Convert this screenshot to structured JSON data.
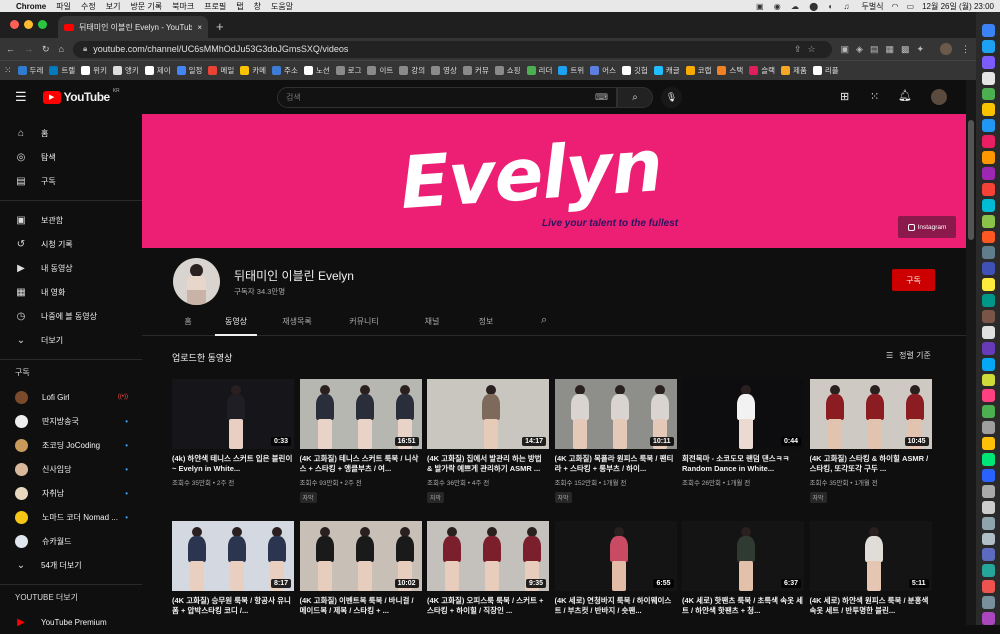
{
  "menubar": {
    "app": "Chrome",
    "items": [
      "파일",
      "수정",
      "보기",
      "방문 기록",
      "북마크",
      "프로필",
      "탭",
      "창",
      "도움말"
    ],
    "right_text": "두벌식",
    "datetime": "12월 26일 (월) 23:00"
  },
  "tab": {
    "title": "뒤태미인 이블린 Evelyn - YouTube",
    "close": "×",
    "new": "+"
  },
  "url": {
    "text": "youtube.com/channel/UC6sMMhOdJu53G3doJGmsSXQ/videos"
  },
  "bookmarks": [
    "두레",
    "트렐",
    "위키",
    "앵키",
    "제이",
    "일정",
    "메일",
    "카메",
    "주소",
    "노션",
    "로그",
    "이트",
    "강의",
    "영상",
    "커뮤",
    "쇼핑",
    "리더",
    "트위",
    "어스",
    "깃헙",
    "캐글",
    "코랩",
    "스택",
    "슬랙",
    "제품",
    "리플"
  ],
  "bookmark_colors": [
    "#2e7bcf",
    "#0079bf",
    "#fff",
    "#ddd",
    "#fff",
    "#4285f4",
    "#ea4335",
    "#f9c300",
    "#3d7bd5",
    "#fff",
    "#8a8a8a",
    "#8a8a8a",
    "#8a8a8a",
    "#8a8a8a",
    "#8a8a8a",
    "#8a8a8a",
    "#4caf50",
    "#1da1f2",
    "#5a7fe0",
    "#fff",
    "#20beff",
    "#f9ab00",
    "#f48024",
    "#e01e5a",
    "#f5a623",
    "#fff"
  ],
  "yt": {
    "logo": "YouTube",
    "region": "KR",
    "search_placeholder": "검색",
    "sidebar": {
      "main": [
        {
          "label": "홈",
          "icon": "home-icon",
          "glyph": "⌂"
        },
        {
          "label": "탐색",
          "icon": "explore-icon",
          "glyph": "◎"
        },
        {
          "label": "구독",
          "icon": "subscriptions-icon",
          "glyph": "▤"
        }
      ],
      "library": [
        {
          "label": "보관함",
          "icon": "library-icon",
          "glyph": "▣"
        },
        {
          "label": "시청 기록",
          "icon": "history-icon",
          "glyph": "↺"
        },
        {
          "label": "내 동영상",
          "icon": "my-videos-icon",
          "glyph": "▶"
        },
        {
          "label": "내 영화",
          "icon": "my-movies-icon",
          "glyph": "▦"
        },
        {
          "label": "나중에 볼 동영상",
          "icon": "watch-later-icon",
          "glyph": "◷"
        },
        {
          "label": "더보기",
          "icon": "chevron-down-icon",
          "glyph": "⌄"
        }
      ],
      "subs_title": "구독",
      "subs": [
        {
          "label": "Lofi Girl",
          "color": "#7a4a2a",
          "badge": "((•))",
          "badge_color": "#ff4e45"
        },
        {
          "label": "딴지방송국",
          "color": "#eee",
          "badge": "•",
          "badge_color": "#3ea6ff"
        },
        {
          "label": "조코딩 JoCoding",
          "color": "#c99a5a",
          "badge": "•",
          "badge_color": "#3ea6ff"
        },
        {
          "label": "신사임당",
          "color": "#d9b99b",
          "badge": "•",
          "badge_color": "#3ea6ff"
        },
        {
          "label": "자취남",
          "color": "#e9d8c0",
          "badge": "•",
          "badge_color": "#3ea6ff"
        },
        {
          "label": "노마드 코더 Nomad ...",
          "color": "#f5c518",
          "badge": "•",
          "badge_color": "#3ea6ff"
        },
        {
          "label": "슈카월드",
          "color": "#dfe6ee",
          "badge": "",
          "badge_color": "#3ea6ff"
        }
      ],
      "more_subs": "54개 더보기",
      "more_title": "YOUTUBE 더보기",
      "premium": "YouTube Premium"
    },
    "banner": {
      "title": "Evelyn",
      "tagline": "Live your talent to the fullest",
      "instagram": "Instagram"
    },
    "channel": {
      "name": "뒤태미인 이블린 Evelyn",
      "subscribers": "구독자 34.3만명",
      "subscribe": "구독"
    },
    "tabs": [
      "홈",
      "동영상",
      "재생목록",
      "커뮤니티",
      "채널",
      "정보"
    ],
    "active_tab": 1,
    "section_title": "업로드한 동영상",
    "sort_label": "정렬 기준",
    "videos": [
      {
        "title": "(4k) 하얀색 테니스 스커트 입은 블린이~ Evelyn in White...",
        "meta": "조회수 35만회 • 2주 전",
        "dur": "0:33",
        "cc": "",
        "bg": "#15151a",
        "skin": "#e8cfc2",
        "cloth": "#1e1e24"
      },
      {
        "title": "(4K 고화질) 테니스 스커트 룩북 / 니삭스 + 스타킹 + 앵클부츠 / 여...",
        "meta": "조회수 93만회 • 2주 전",
        "dur": "16:51",
        "cc": "자막",
        "bg": "#b7b7b2",
        "skin": "#e9d2c6",
        "cloth": "#2a2d3a"
      },
      {
        "title": "(4K 고화질) 집에서 발관리 하는 방법 & 발가락 예쁘게 관리하기 ASMR ...",
        "meta": "조회수 36만회 • 4주 전",
        "dur": "14:17",
        "cc": "자막",
        "bg": "#c9c5bf",
        "skin": "#e7cbb9",
        "cloth": "#7d6a5b"
      },
      {
        "title": "(4K 고화질) 목폴라 원피스 룩북 / 팬티라 + 스타킹 + 롱부츠 / 하이...",
        "meta": "조회수 152만회 • 1개월 전",
        "dur": "10:11",
        "cc": "자막",
        "bg": "#8e8e8a",
        "skin": "#e4c9b8",
        "cloth": "#d9d4cf"
      },
      {
        "title": "회전목마 - 소코도모 랜덤 댄스ㅋㅋ Random Dance in White...",
        "meta": "조회수 26만회 • 1개월 전",
        "dur": "0:44",
        "cc": "",
        "bg": "#0d0d10",
        "skin": "#eadad2",
        "cloth": "#f2f2f2"
      },
      {
        "title": "(4K 고화질) 스타킹 & 하이힐 ASMR / 스타킹, 또각또각 구두 ...",
        "meta": "조회수 35만회 • 1개월 전",
        "dur": "10:45",
        "cc": "자막",
        "bg": "#cfc9c4",
        "skin": "#e2c3b0",
        "cloth": "#8a1c22"
      },
      {
        "title": "(4K 고화질) 승무원 룩북 / 항공사 유니폼 + 압박스타킹 코디 /...",
        "meta": "",
        "dur": "8:17",
        "cc": "",
        "bg": "#d4d8e0",
        "skin": "#e9cfc0",
        "cloth": "#2c3550"
      },
      {
        "title": "(4K 고화질) 이벤트복 룩북 / 바니걸 / 메이드복 / 제복 / 스타킹 + ...",
        "meta": "",
        "dur": "10:02",
        "cc": "",
        "bg": "#c8bfb6",
        "skin": "#e6cdbd",
        "cloth": "#1a1a1a"
      },
      {
        "title": "(4K 고화질) 오피스룩 룩북 / 스커트 + 스타킹 + 하이힐 / 직장인 ...",
        "meta": "",
        "dur": "9:35",
        "cc": "",
        "bg": "#c4c0bc",
        "skin": "#e8cdbc",
        "cloth": "#7c1f2c"
      },
      {
        "title": "(4K 세로) 연청바지 룩북 / 하이웨이스트 / 부츠컷 / 반바지 / 숏팬...",
        "meta": "",
        "dur": "6:55",
        "cc": "",
        "bg": "#141414",
        "skin": "#e3bca6",
        "cloth": "#c84a63"
      },
      {
        "title": "(4K 세로) 핫팬츠 룩북 / 초록색 속옷 세트 / 하얀색 핫팬츠 + 청...",
        "meta": "",
        "dur": "6:37",
        "cc": "",
        "bg": "#141414",
        "skin": "#e2c0aa",
        "cloth": "#2f3a33"
      },
      {
        "title": "(4K 세로) 하얀색 원피스 룩북 / 분홍색 속옷 세트 / 반투명한 블린...",
        "meta": "",
        "dur": "5:11",
        "cc": "",
        "bg": "#141414",
        "skin": "#e5c6b3",
        "cloth": "#e0ddd8"
      }
    ]
  }
}
